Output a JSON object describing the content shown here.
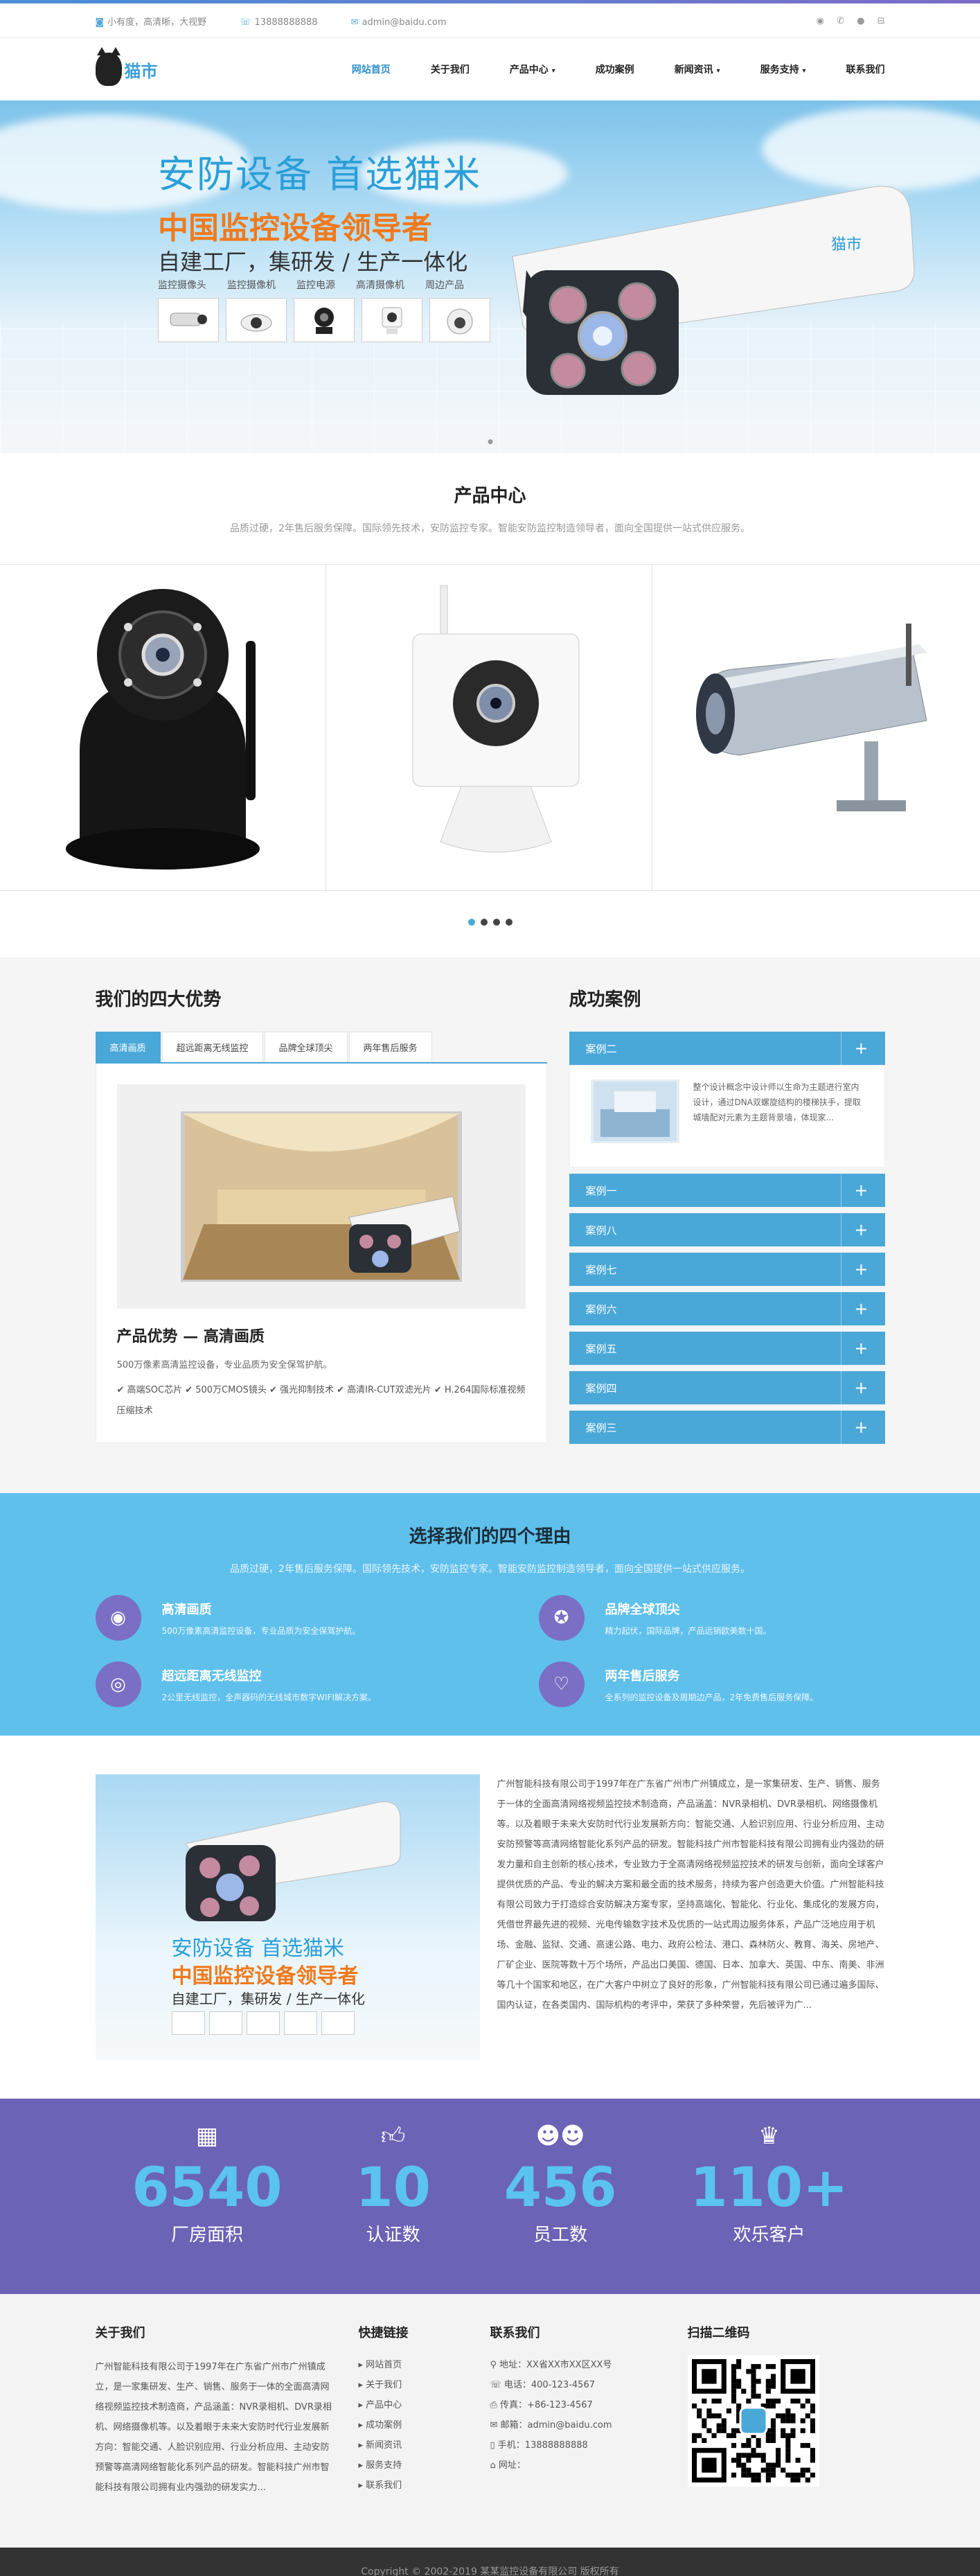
{
  "topbar": {
    "company": "小有度，高清晰，大视野",
    "phone": "13888888888",
    "email": "admin@baidu.com"
  },
  "logo": {
    "text": "猫市"
  },
  "nav": {
    "items": [
      {
        "label": "网站首页"
      },
      {
        "label": "关于我们"
      },
      {
        "label": "产品中心"
      },
      {
        "label": "成功案例"
      },
      {
        "label": "新闻资讯"
      },
      {
        "label": "服务支持"
      },
      {
        "label": "联系我们"
      }
    ]
  },
  "banner": {
    "slogan": "安防设备 首选猫米",
    "headline": "中国监控设备领导者",
    "subline": "自建工厂，集研发 / 生产一体化",
    "tags": [
      "监控摄像头",
      "监控摄像机",
      "监控电源",
      "高清摄像机",
      "周边产品"
    ],
    "brand": "猫市"
  },
  "products": {
    "title": "产品中心",
    "desc": "品质过硬，2年售后服务保障。国际领先技术，安防监控专家。智能安防监控制造领导者，面向全国提供一站式供应服务。"
  },
  "advantages": {
    "title": "我们的四大优势",
    "tabs": [
      "高清画质",
      "超远距离无线监控",
      "品牌全球顶尖",
      "两年售后服务"
    ],
    "panel_title": "产品优势 — 高清画质",
    "panel_desc1": "500万像素高清监控设备，专业品质为安全保驾护航。",
    "panel_desc2": "✔ 高端SOC芯片  ✔ 500万CMOS镜头  ✔ 强光抑制技术  ✔ 高清IR-CUT双滤光片  ✔ H.264国际标准视频压缩技术"
  },
  "cases": {
    "title": "成功案例",
    "open_label": "案例二",
    "open_text": "整个设计概念中设计师以生命为主题进行室内设计，通过DNA双螺旋结构的楼梯扶手，提取城墙配对元素为主题背景墙，体现家...",
    "items": [
      "案例一",
      "案例八",
      "案例七",
      "案例六",
      "案例五",
      "案例四",
      "案例三"
    ]
  },
  "reasons": {
    "title": "选择我们的四个理由",
    "desc": "品质过硬，2年售后服务保障。国际领先技术，安防监控专家。智能安防监控制造领导者，面向全国提供一站式供应服务。",
    "items": [
      {
        "title": "高清画质",
        "desc": "500万像素高清监控设备，专业品质为安全保驾护航。"
      },
      {
        "title": "品牌全球顶尖",
        "desc": "精力起伏，国际品牌，产品远销欧美数十国。"
      },
      {
        "title": "超远距离无线监控",
        "desc": "2公里无线监控，全声器码的无线城市数字WIFI解决方案。"
      },
      {
        "title": "两年售后服务",
        "desc": "全系列的监控设备及周期边产品，2年免费售后服务保障。"
      }
    ]
  },
  "about": {
    "img_slogan": "安防设备 首选猫米",
    "img_headline": "中国监控设备领导者",
    "img_sub": "自建工厂，集研发 / 生产一体化",
    "text": "广州智能科技有限公司于1997年在广东省广州市广州镇成立，是一家集研发、生产、销售、服务于一体的全面高清网络视频监控技术制造商，产品涵盖：NVR录相机、DVR录相机、网络摄像机等。以及着眼于未来大安防时代行业发展新方向：智能交通、人脸识别应用、行业分析应用、主动安防预警等高清网络智能化系列产品的研发。智能科技广州市智能科技有限公司拥有业内强劲的研发力量和自主创新的核心技术，专业致力于全高清网络视频监控技术的研发与创新，面向全球客户提供优质的产品、专业的解决方案和最全面的技术服务，持续为客户创造更大价值。广州智能科技有限公司致力于打造综合安防解决方案专家，坚持高端化、智能化、行业化、集成化的发展方向，凭借世界最先进的视频、光电传输数字技术及优质的一站式周边服务体系，产品广泛地应用于机场、金融、监狱、交通、高速公路、电力、政府公检法、港口、森林防火、教育、海关、房地产、厂矿企业、医院等数十万个场所，产品出口美国、德国、日本、加拿大、英国、中东、南美、非洲等几十个国家和地区，在广大客户中树立了良好的形象，广州智能科技有限公司已通过遍多国际、国内认证，在各类国内、国际机构的考评中，荣获了多种荣誉，先后被评为广..."
  },
  "stats": {
    "items": [
      {
        "icon": "building-icon",
        "num": "6540",
        "label": "厂房面积"
      },
      {
        "icon": "thumbs-up-icon",
        "num": "10",
        "label": "认证数"
      },
      {
        "icon": "users-icon",
        "num": "456",
        "label": "员工数"
      },
      {
        "icon": "trophy-icon",
        "num": "110+",
        "label": "欢乐客户"
      }
    ]
  },
  "footer": {
    "about_title": "关于我们",
    "about_text": "广州智能科技有限公司于1997年在广东省广州市广州镇成立，是一家集研发、生产、销售、服务于一体的全面高清网络视频监控技术制造商，产品涵盖：NVR录相机、DVR录相机、网络摄像机等。以及着眼于未来大安防时代行业发展新方向：智能交通、人脸识别应用、行业分析应用、主动安防预警等高清网络智能化系列产品的研发。智能科技广州市智能科技有限公司拥有业内强劲的研发实力...",
    "links_title": "快捷链接",
    "links": [
      "网站首页",
      "关于我们",
      "产品中心",
      "成功案例",
      "新闻资讯",
      "服务支持",
      "联系我们"
    ],
    "contact_title": "联系我们",
    "contact": [
      "地址：XX省XX市XX区XX号",
      "电话：400-123-4567",
      "传真：+86-123-4567",
      "邮箱：admin@baidu.com",
      "手机：13888888888",
      "网址："
    ],
    "qr_title": "扫描二维码",
    "copyright": "Copyright © 2002-2019 某某监控设备有限公司 版权所有"
  },
  "colors": {
    "accent": "#4aa8d8",
    "orange": "#f07a1c",
    "purple": "#6b63b5",
    "sky": "#5fc0ec"
  }
}
